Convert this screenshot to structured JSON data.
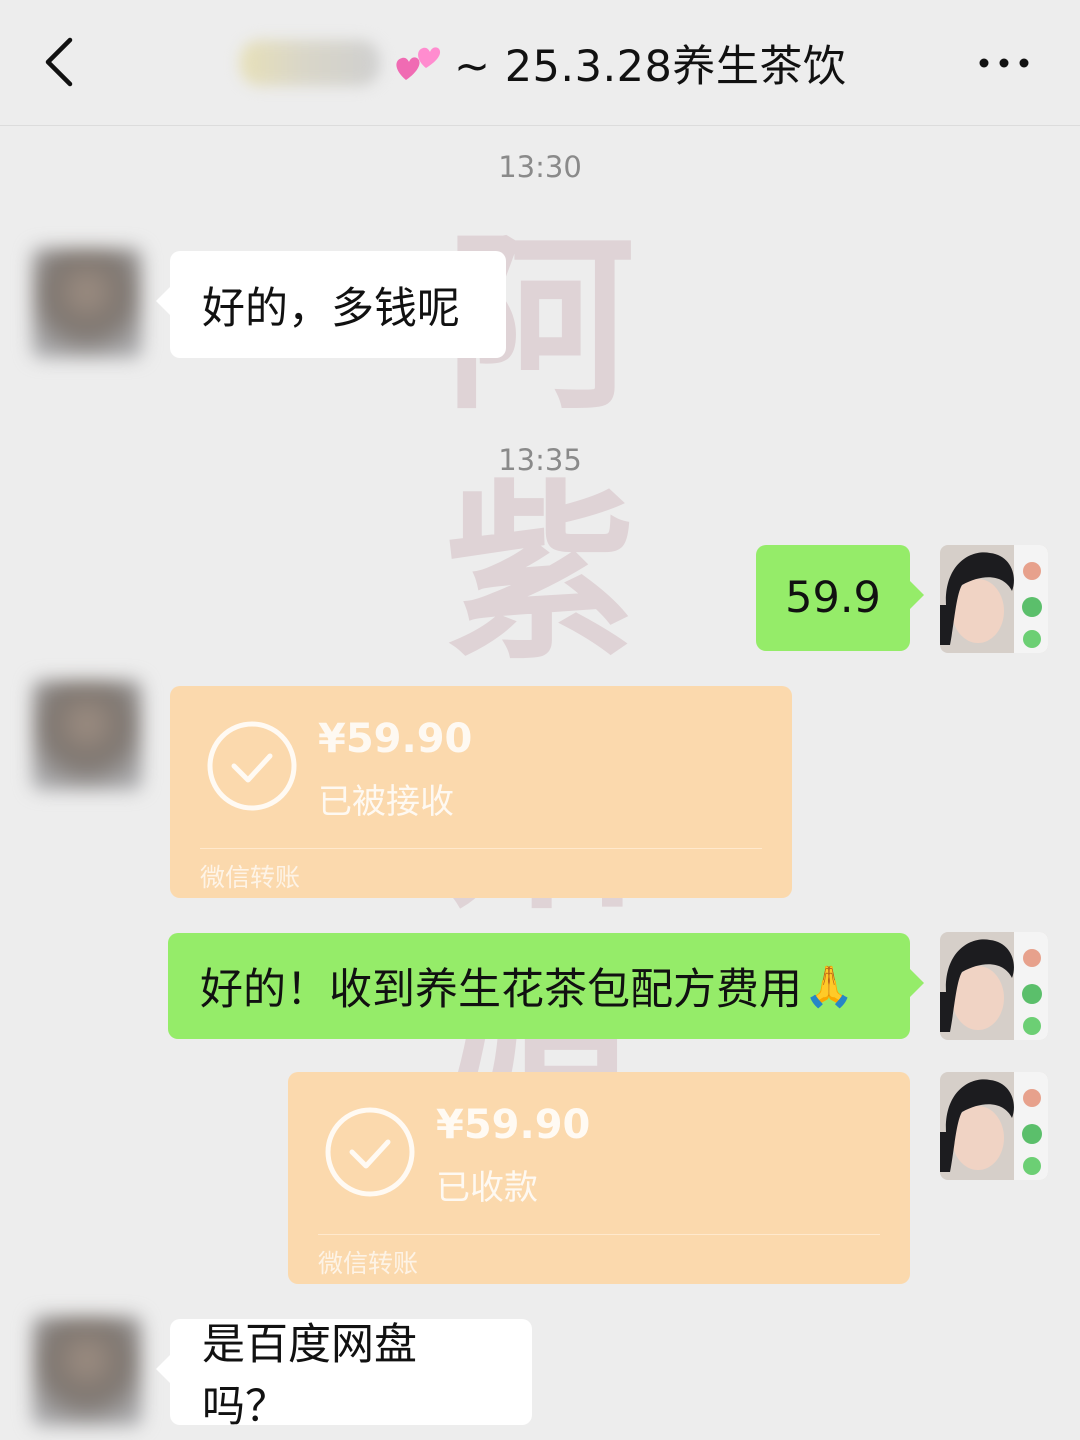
{
  "header": {
    "title": "~ 25.3.28养生茶饮",
    "back_icon": "chevron-left-icon",
    "more_icon": "more-dots-icon",
    "title_icon": "two-hearts-icon"
  },
  "messages": {
    "time_1": "13:30",
    "msg_1": "好的，多钱呢",
    "time_2": "13:35",
    "msg_2": "59.9",
    "transfer_1": {
      "amount": "¥59.90",
      "status": "已被接收",
      "footer": "微信转账"
    },
    "msg_3": "好的！收到养生花茶包配方费用",
    "msg_3_emoji": "🙏",
    "transfer_2": {
      "amount": "¥59.90",
      "status": "已收款",
      "footer": "微信转账"
    },
    "msg_4": "是百度网盘吗？"
  },
  "watermark": {
    "chars": [
      "阿",
      "紫",
      "姑",
      "娘"
    ]
  },
  "colors": {
    "background": "#ededed",
    "green_bubble": "#95ec69",
    "white_bubble": "#ffffff",
    "transfer_card": "#fbd9ad"
  }
}
